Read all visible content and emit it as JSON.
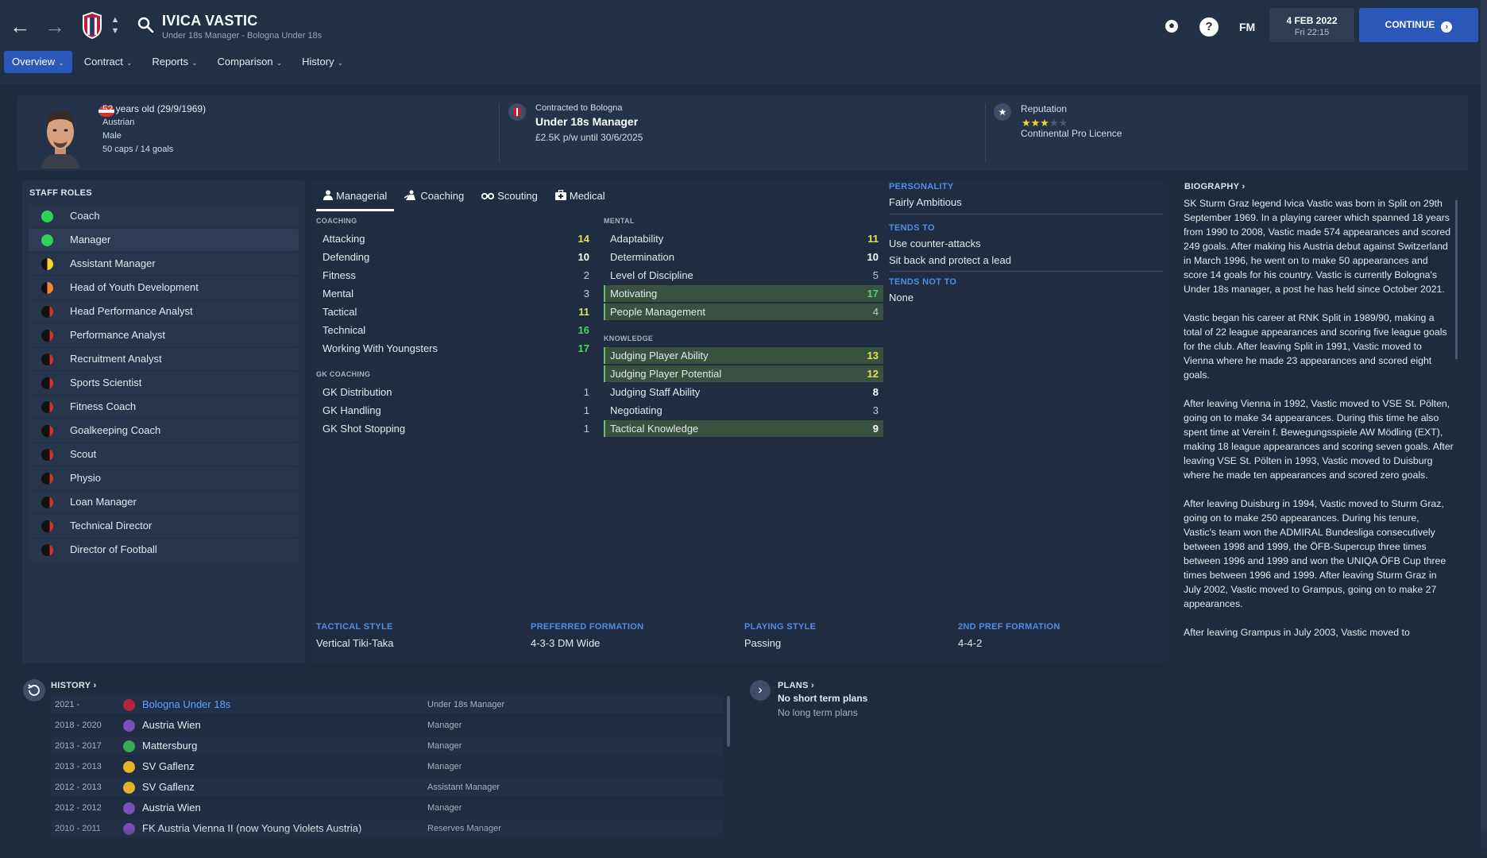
{
  "header": {
    "title": "IVICA VASTIC",
    "subtitle": "Under 18s Manager - Bologna Under 18s",
    "fm_label": "FM",
    "date": "4 FEB 2022",
    "time": "Fri 22:15",
    "continue_label": "CONTINUE"
  },
  "menus": [
    {
      "label": "Overview"
    },
    {
      "label": "Contract"
    },
    {
      "label": "Reports"
    },
    {
      "label": "Comparison"
    },
    {
      "label": "History"
    }
  ],
  "profile": {
    "age": "52 years old (29/9/1969)",
    "nationality": "Austrian",
    "gender": "Male",
    "caps": "50 caps / 14 goals",
    "contract_label": "Contracted to Bologna",
    "contract_role": "Under 18s Manager",
    "contract_terms": "£2.5K p/w until 30/6/2025",
    "reputation_label": "Reputation",
    "reputation_stars": 3,
    "licence": "Continental Pro Licence"
  },
  "staff_roles": {
    "heading": "STAFF ROLES",
    "items": [
      {
        "label": "Coach",
        "color": "#2fd157",
        "type": "full"
      },
      {
        "label": "Manager",
        "color": "#2fd157",
        "type": "full"
      },
      {
        "label": "Assistant Manager",
        "color": "#f2d42c",
        "type": "half"
      },
      {
        "label": "Head of Youth Development",
        "color": "#ef8a2c",
        "type": "half"
      },
      {
        "label": "Head Performance Analyst",
        "color": "#d8332b",
        "type": "sliver"
      },
      {
        "label": "Performance Analyst",
        "color": "#d8332b",
        "type": "sliver"
      },
      {
        "label": "Recruitment Analyst",
        "color": "#d8332b",
        "type": "sliver"
      },
      {
        "label": "Sports Scientist",
        "color": "#d8332b",
        "type": "sliver"
      },
      {
        "label": "Fitness Coach",
        "color": "#d8332b",
        "type": "sliver"
      },
      {
        "label": "Goalkeeping Coach",
        "color": "#d8332b",
        "type": "sliver"
      },
      {
        "label": "Scout",
        "color": "#d8332b",
        "type": "sliver"
      },
      {
        "label": "Physio",
        "color": "#d8332b",
        "type": "sliver"
      },
      {
        "label": "Loan Manager",
        "color": "#d8332b",
        "type": "sliver"
      },
      {
        "label": "Technical Director",
        "color": "#d8332b",
        "type": "sliver"
      },
      {
        "label": "Director of Football",
        "color": "#d8332b",
        "type": "sliver"
      }
    ]
  },
  "tabs": [
    {
      "label": "Managerial",
      "icon": "person-icon"
    },
    {
      "label": "Coaching",
      "icon": "coach-icon"
    },
    {
      "label": "Scouting",
      "icon": "binoculars-icon"
    },
    {
      "label": "Medical",
      "icon": "medical-icon"
    }
  ],
  "attributes": {
    "coaching_heading": "COACHING",
    "coaching": [
      {
        "label": "Attacking",
        "value": "14",
        "tone": "y"
      },
      {
        "label": "Defending",
        "value": "10",
        "tone": "w"
      },
      {
        "label": "Fitness",
        "value": "2",
        "tone": "n"
      },
      {
        "label": "Mental",
        "value": "3",
        "tone": "n"
      },
      {
        "label": "Tactical",
        "value": "11",
        "tone": "y"
      },
      {
        "label": "Technical",
        "value": "16",
        "tone": "g"
      },
      {
        "label": "Working With Youngsters",
        "value": "17",
        "tone": "g"
      }
    ],
    "gk_heading": "GK COACHING",
    "gk": [
      {
        "label": "GK Distribution",
        "value": "1",
        "tone": "n"
      },
      {
        "label": "GK Handling",
        "value": "1",
        "tone": "n"
      },
      {
        "label": "GK Shot Stopping",
        "value": "1",
        "tone": "n"
      }
    ],
    "mental_heading": "MENTAL",
    "mental": [
      {
        "label": "Adaptability",
        "value": "11",
        "tone": "y"
      },
      {
        "label": "Determination",
        "value": "10",
        "tone": "w"
      },
      {
        "label": "Level of Discipline",
        "value": "5",
        "tone": "n"
      },
      {
        "label": "Motivating",
        "value": "17",
        "tone": "g",
        "hl": true
      },
      {
        "label": "People Management",
        "value": "4",
        "tone": "n",
        "hl": true
      }
    ],
    "knowledge_heading": "KNOWLEDGE",
    "knowledge": [
      {
        "label": "Judging Player Ability",
        "value": "13",
        "tone": "y",
        "hl": true
      },
      {
        "label": "Judging Player Potential",
        "value": "12",
        "tone": "y",
        "hl": true
      },
      {
        "label": "Judging Staff Ability",
        "value": "8",
        "tone": "w"
      },
      {
        "label": "Negotiating",
        "value": "3",
        "tone": "n"
      },
      {
        "label": "Tactical Knowledge",
        "value": "9",
        "tone": "w",
        "hl": true
      }
    ]
  },
  "personality": {
    "heading": "PERSONALITY",
    "value": "Fairly Ambitious",
    "tends_heading": "TENDS TO",
    "tends": [
      "Use counter-attacks",
      "Sit back and protect a lead"
    ],
    "tends_not_heading": "TENDS NOT TO",
    "tends_not": "None"
  },
  "tactics": [
    {
      "heading": "TACTICAL STYLE",
      "value": "Vertical Tiki-Taka"
    },
    {
      "heading": "PREFERRED FORMATION",
      "value": "4-3-3 DM Wide"
    },
    {
      "heading": "PLAYING STYLE",
      "value": "Passing"
    },
    {
      "heading": "2ND PREF FORMATION",
      "value": "4-4-2"
    }
  ],
  "biography": {
    "heading": "BIOGRAPHY",
    "paragraphs": [
      "SK Sturm Graz legend Ivica Vastic was born in Split on 29th September 1969. In a playing career which spanned 18 years from 1990 to 2008, Vastic made 574 appearances and scored 249 goals. After making his Austria debut against Switzerland in March 1996, he went on to make 50 appearances and score 14 goals for his country. Vastic is currently Bologna's Under 18s manager, a post he has held since October 2021.",
      "Vastic began his career at RNK Split in 1989/90, making a total of 22 league appearances and scoring five league goals for the club. After leaving Split in 1991, Vastic moved to Vienna where he made 23 appearances and scored eight goals.",
      "After leaving Vienna in 1992, Vastic moved to VSE St. Pölten, going on to make 34 appearances. During this time he also spent time at Verein f. Bewegungsspiele AW Mödling (EXT), making 18 league appearances and scoring seven goals. After leaving VSE St. Pölten in 1993, Vastic moved to Duisburg where he made ten appearances and scored zero goals.",
      "After leaving Duisburg in 1994, Vastic moved to Sturm Graz, going on to make 250 appearances. During his tenure, Vastic's team won the ADMIRAL Bundesliga consecutively between 1998 and 1999, the ÖFB-Supercup three times between 1996 and 1999 and won the UNIQA ÖFB Cup three times between 1996 and 1999. After leaving Sturm Graz in July 2002, Vastic moved to Grampus, going on to make 27 appearances.",
      "After leaving Grampus in July 2003, Vastic moved to"
    ]
  },
  "history": {
    "heading": "HISTORY",
    "rows": [
      {
        "years": "2021 -",
        "club": "Bologna Under 18s",
        "role": "Under 18s Manager",
        "logo": "#b3243a",
        "link": true
      },
      {
        "years": "2018 - 2020",
        "club": "Austria Wien",
        "role": "Manager",
        "logo": "#7b4fb5"
      },
      {
        "years": "2013 - 2017",
        "club": "Mattersburg",
        "role": "Manager",
        "logo": "#3aa856"
      },
      {
        "years": "2013 - 2013",
        "club": "SV Gaflenz",
        "role": "Manager",
        "logo": "#e2b429"
      },
      {
        "years": "2012 - 2013",
        "club": "SV Gaflenz",
        "role": "Assistant Manager",
        "logo": "#e2b429"
      },
      {
        "years": "2012 - 2012",
        "club": "Austria Wien",
        "role": "Manager",
        "logo": "#7b4fb5"
      },
      {
        "years": "2010 - 2011",
        "club": "FK Austria Vienna II (now Young Violets Austria)",
        "role": "Reserves Manager",
        "logo": "#7b4fb5"
      }
    ]
  },
  "plans": {
    "heading": "PLANS",
    "short": "No short term plans",
    "long": "No long term plans"
  }
}
